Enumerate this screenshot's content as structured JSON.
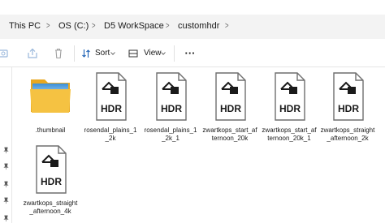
{
  "breadcrumb": {
    "items": [
      "This PC",
      "OS (C:)",
      "D5 WorkSpace",
      "customhdr"
    ]
  },
  "toolbar": {
    "sort_label": "Sort",
    "view_label": "View",
    "more_label": "···"
  },
  "files": [
    {
      "name": ".thumbnail",
      "type": "folder"
    },
    {
      "name": "rosendal_plains_1_2k",
      "type": "hdr"
    },
    {
      "name": "rosendal_plains_1_2k_1",
      "type": "hdr"
    },
    {
      "name": "zwartkops_start_afternoon_20k",
      "type": "hdr"
    },
    {
      "name": "zwartkops_start_afternoon_20k_1",
      "type": "hdr"
    },
    {
      "name": "zwartkops_straight_afternoon_2k",
      "type": "hdr"
    },
    {
      "name": "zwartkops_straight_afternoon_4k",
      "type": "hdr"
    }
  ],
  "hdr_badge": "HDR",
  "colors": {
    "breadcrumb_bg": "#f3f3f3",
    "folder_yellow": "#f5c242",
    "folder_back": "#e8a820",
    "icon_outline": "#6e6e6e",
    "accent": "#1a5fb4"
  }
}
